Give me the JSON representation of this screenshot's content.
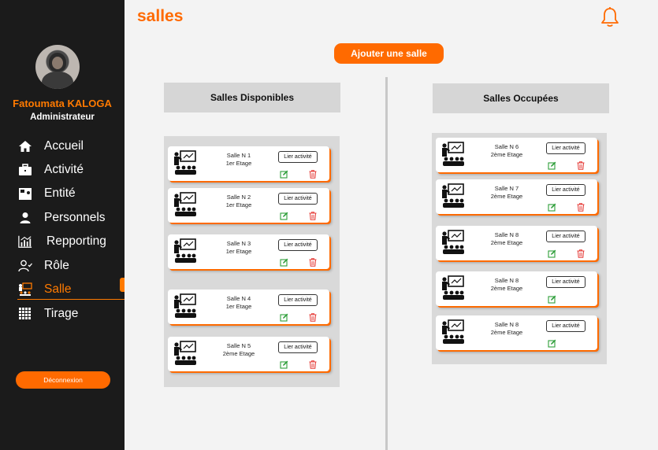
{
  "header": {
    "title": "salles",
    "bell_icon": "bell-icon"
  },
  "user": {
    "name": "Fatoumata KALOGA",
    "role": "Administrateur"
  },
  "sidebar": {
    "items": [
      {
        "label": "Accueil",
        "icon": "home-icon"
      },
      {
        "label": "Activité",
        "icon": "briefcase-icon"
      },
      {
        "label": "Entité",
        "icon": "entity-icon"
      },
      {
        "label": "Personnels",
        "icon": "person-icon"
      },
      {
        "label": "Repporting",
        "icon": "report-icon"
      },
      {
        "label": "Rôle",
        "icon": "role-icon"
      },
      {
        "label": "Salle",
        "icon": "classroom-icon",
        "active": true
      },
      {
        "label": "Tirage",
        "icon": "grid-icon"
      }
    ],
    "logout_label": "Déconnexion"
  },
  "actions": {
    "add_room_label": "Ajouter une salle"
  },
  "available": {
    "title": "Salles Disponibles",
    "rooms": [
      {
        "name": "Salle N 1",
        "floor": "1er Etage",
        "link_label": "Lier activité"
      },
      {
        "name": "Salle N 2",
        "floor": "1er Etage",
        "link_label": "Lier activité"
      },
      {
        "name": "Salle N 3",
        "floor": "1er Etage",
        "link_label": "Lier activité"
      },
      {
        "name": "Salle N 4",
        "floor": "1er Etage",
        "link_label": "Lier activité"
      },
      {
        "name": "Salle N 5",
        "floor": "2ème Etage",
        "link_label": "Lier activité"
      }
    ]
  },
  "occupied": {
    "title": "Salles  Occupées",
    "rooms": [
      {
        "name": "Salle N 6",
        "floor": "2ème Etage",
        "link_label": "Lier activité"
      },
      {
        "name": "Salle N 7",
        "floor": "2ème Etage",
        "link_label": "Lier activité"
      },
      {
        "name": "Salle N 8",
        "floor": "2ème Etage",
        "link_label": "Lier activité"
      },
      {
        "name": "Salle N 8",
        "floor": "2ème Etage",
        "link_label": "Lier activité"
      },
      {
        "name": "Salle N 8",
        "floor": "2ème Etage",
        "link_label": "Lier activité"
      }
    ]
  },
  "colors": {
    "accent": "#ff6a00",
    "sidebar_bg": "#1b1b1b",
    "edit": "#2e9e3a",
    "delete": "#e53935"
  }
}
